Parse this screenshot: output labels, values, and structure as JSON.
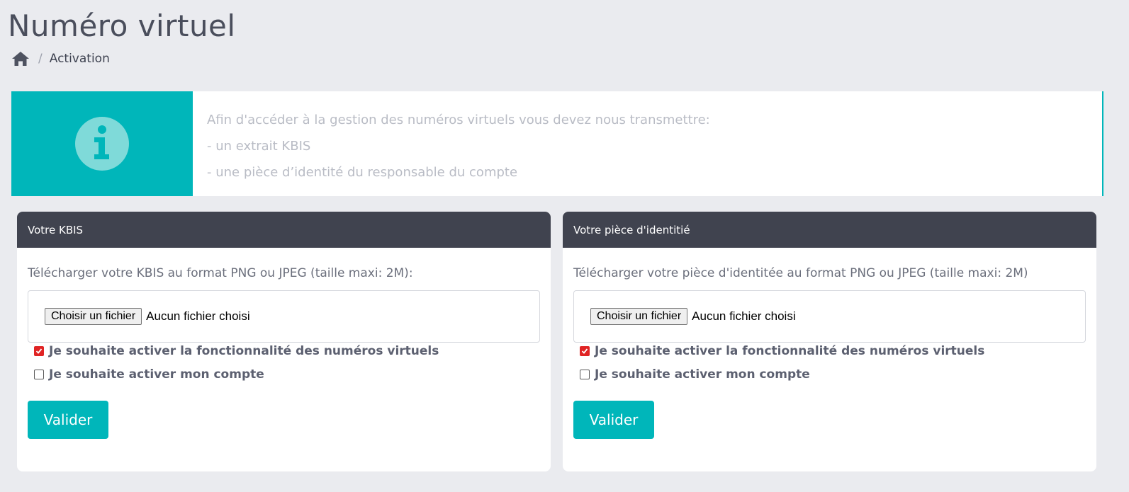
{
  "page": {
    "title": "Numéro virtuel",
    "breadcrumb": {
      "home_icon": "home-icon",
      "separator": "/",
      "current": "Activation"
    }
  },
  "info": {
    "icon": "info-icon",
    "lines": [
      "Afin d'accéder à la gestion des numéros virtuels vous devez nous transmettre:",
      "- un extrait KBIS",
      "- une pièce d’identité du responsable du compte"
    ]
  },
  "colors": {
    "accent": "#00b6ba",
    "header": "#40434f",
    "checkbox_checked": "#e02424"
  },
  "kbis_card": {
    "title": "Votre KBIS",
    "upload_label": "Télécharger votre KBIS au format PNG ou JPEG (taille maxi: 2M):",
    "file_button": "Choisir un fichier",
    "file_status": "Aucun fichier choisi",
    "checkboxes": [
      {
        "label": "Je souhaite activer la fonctionnalité des numéros virtuels",
        "checked": true
      },
      {
        "label": "Je souhaite activer mon compte",
        "checked": false
      }
    ],
    "submit": "Valider"
  },
  "id_card": {
    "title": "Votre pièce d'identitié",
    "upload_label": "Télécharger votre pièce d'identitée au format PNG ou JPEG (taille maxi: 2M)",
    "file_button": "Choisir un fichier",
    "file_status": "Aucun fichier choisi",
    "checkboxes": [
      {
        "label": "Je souhaite activer la fonctionnalité des numéros virtuels",
        "checked": true
      },
      {
        "label": "Je souhaite activer mon compte",
        "checked": false
      }
    ],
    "submit": "Valider"
  }
}
